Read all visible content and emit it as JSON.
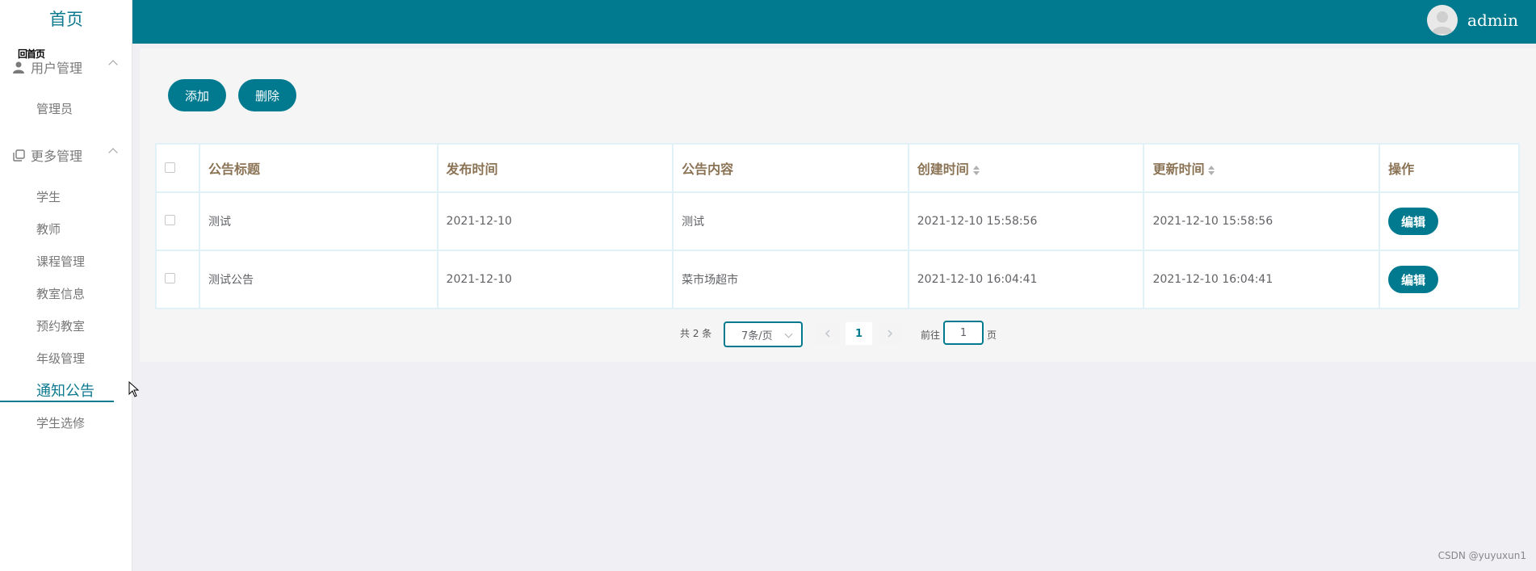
{
  "sidebar": {
    "home": "首页",
    "tooltip": "回首页",
    "groups": [
      {
        "label": "用户管理",
        "icon": "user-icon",
        "items": [
          "管理员"
        ]
      },
      {
        "label": "更多管理",
        "icon": "copy-icon",
        "items": [
          "学生",
          "教师",
          "课程管理",
          "教室信息",
          "预约教室",
          "年级管理",
          "通知公告",
          "学生选修"
        ]
      }
    ],
    "active_item": "通知公告"
  },
  "header": {
    "user": "admin",
    "avatar_icon": "avatar-icon"
  },
  "toolbar": {
    "add_label": "添加",
    "delete_label": "删除"
  },
  "table": {
    "columns": [
      "公告标题",
      "发布时间",
      "公告内容",
      "创建时间",
      "更新时间",
      "操作"
    ],
    "rows": [
      {
        "title": "测试",
        "publish": "2021-12-10",
        "content": "测试",
        "created": "2021-12-10 15:58:56",
        "updated": "2021-12-10 15:58:56",
        "action": "编辑"
      },
      {
        "title": "测试公告",
        "publish": "2021-12-10",
        "content": "菜市场超市",
        "created": "2021-12-10 16:04:41",
        "updated": "2021-12-10 16:04:41",
        "action": "编辑"
      }
    ]
  },
  "pagination": {
    "total": "共 2 条",
    "page_size": "7条/页",
    "current": "1",
    "goto_label": "前往",
    "goto_value": "1",
    "page_suffix": "页"
  },
  "watermark": "CSDN @yuyuxun1",
  "colors": {
    "primary": "#017a90",
    "header_text": "#8b7355"
  }
}
